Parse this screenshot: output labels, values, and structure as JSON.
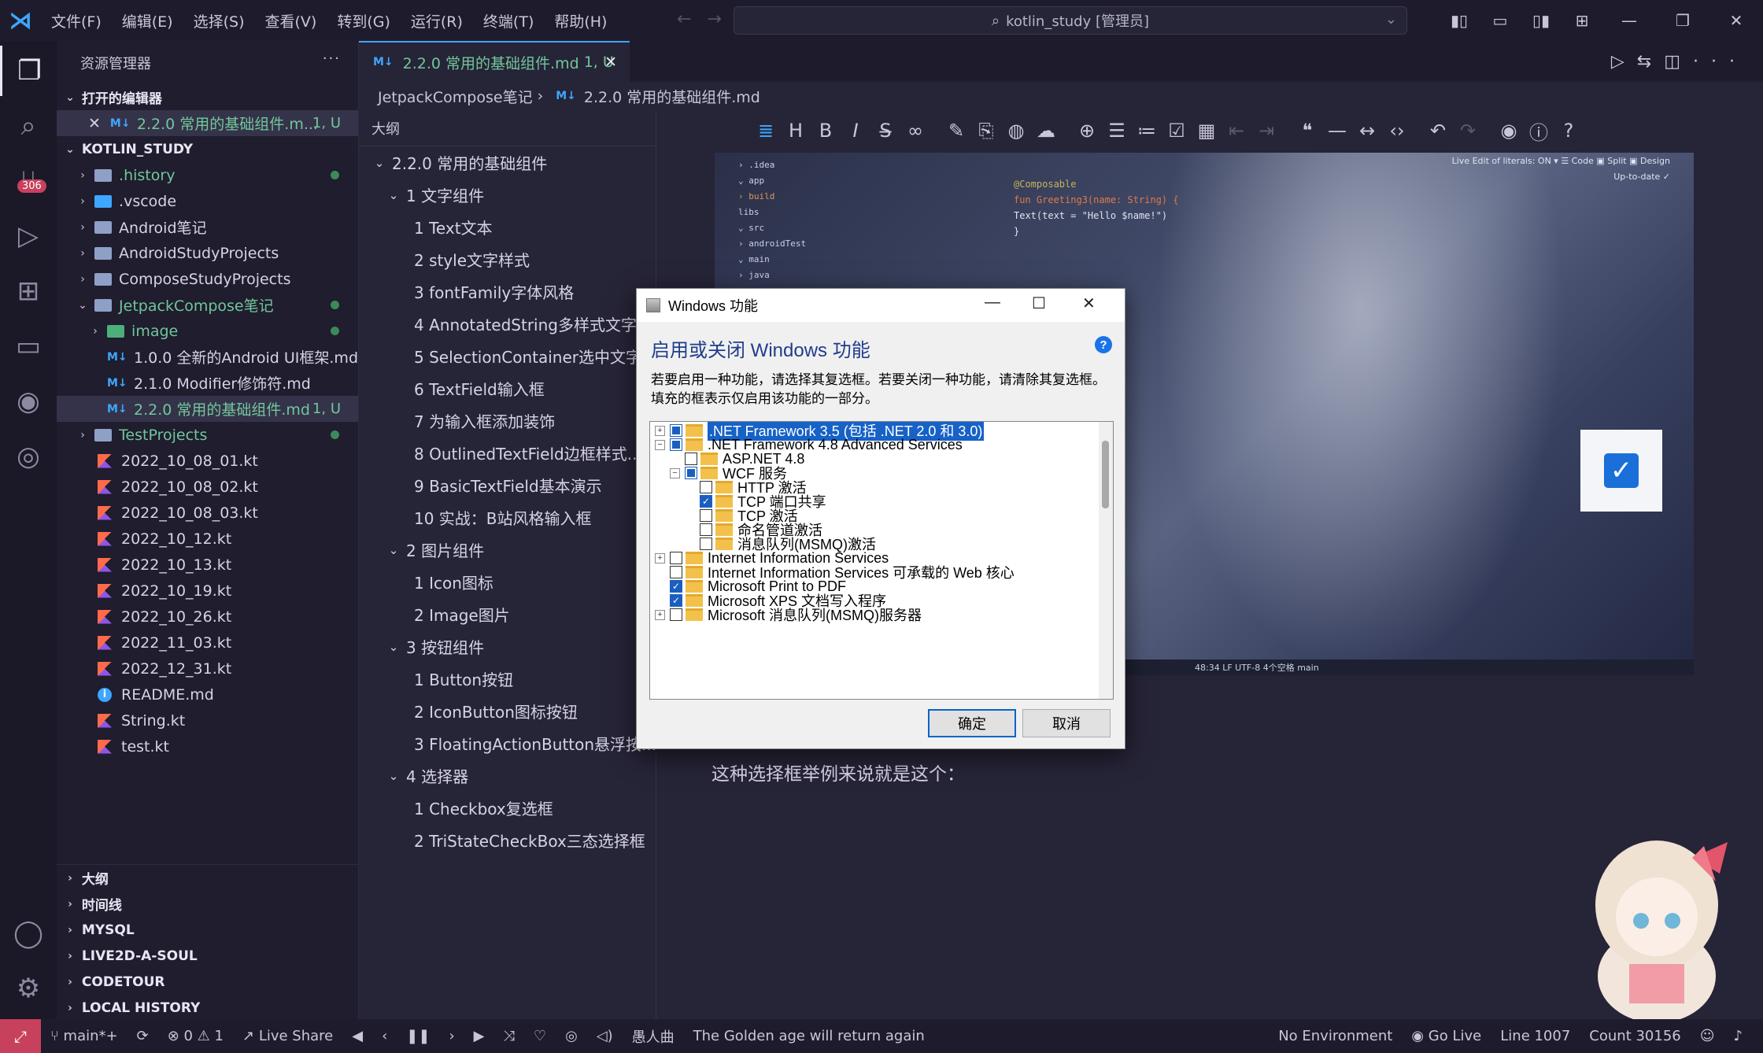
{
  "titlebar": {
    "menus": [
      "文件(F)",
      "编辑(E)",
      "选择(S)",
      "查看(V)",
      "转到(G)",
      "运行(R)",
      "终端(T)",
      "帮助(H)"
    ],
    "search": "kotlin_study [管理员]"
  },
  "activity": {
    "scm_badge": "306"
  },
  "explorer": {
    "title": "资源管理器",
    "open_editors_label": "打开的编辑器",
    "open_editor": {
      "name": "2.2.0 常用的基础组件.m...",
      "suffix": "1, U"
    },
    "root_label": "KOTLIN_STUDY",
    "items": [
      {
        "name": ".history"
      },
      {
        "name": ".vscode"
      },
      {
        "name": "Android笔记"
      },
      {
        "name": "AndroidStudyProjects"
      },
      {
        "name": "ComposeStudyProjects"
      },
      {
        "name": "JetpackCompose笔记"
      },
      {
        "name": "image"
      },
      {
        "name": "1.0.0 全新的Android UI框架.md"
      },
      {
        "name": "2.1.0 Modifier修饰符.md"
      },
      {
        "name": "2.2.0 常用的基础组件.md",
        "suffix": "1, U"
      },
      {
        "name": "TestProjects"
      },
      {
        "name": "2022_10_08_01.kt"
      },
      {
        "name": "2022_10_08_02.kt"
      },
      {
        "name": "2022_10_08_03.kt"
      },
      {
        "name": "2022_10_12.kt"
      },
      {
        "name": "2022_10_13.kt"
      },
      {
        "name": "2022_10_19.kt"
      },
      {
        "name": "2022_10_26.kt"
      },
      {
        "name": "2022_11_03.kt"
      },
      {
        "name": "2022_12_31.kt"
      },
      {
        "name": "README.md"
      },
      {
        "name": "String.kt"
      },
      {
        "name": "test.kt"
      }
    ],
    "bottom_sections": [
      "大纲",
      "时间线",
      "MYSQL",
      "LIVE2D-A-SOUL",
      "CODETOUR",
      "LOCAL HISTORY"
    ]
  },
  "editor": {
    "tab_label": "2.2.0 常用的基础组件.md",
    "tab_suffix": "1, U",
    "breadcrumb": [
      "JetpackCompose笔记",
      "2.2.0 常用的基础组件.md"
    ]
  },
  "outline": {
    "title": "大纲",
    "items": [
      "2.2.0 常用的基础组件",
      "1 文字组件",
      "1 Text文本",
      "2 style文字样式",
      "3 fontFamily字体风格",
      "4 AnnotatedString多样式文字",
      "5 SelectionContainer选中文字",
      "6 TextField输入框",
      "7 为输入框添加装饰",
      "8 OutlinedTextField边框样式...",
      "9 BasicTextField基本演示",
      "10 实战：B站风格输入框",
      "2 图片组件",
      "1 Icon图标",
      "2 Image图片",
      "3 按钮组件",
      "1 Button按钮",
      "2 IconButton图标按钮",
      "3 FloatingActionButton悬浮按...",
      "4 选择器",
      "1 Checkbox复选框",
      "2 TriStateCheckBox三态选择框"
    ]
  },
  "markdown": {
    "paragraph": "这种选择框举例来说就是这个：",
    "screenshot": {
      "tree": [
        "› .idea",
        "⌄ app",
        "  › build",
        "    libs",
        "  ⌄ src",
        "    › androidTest",
        "    ⌄ main",
        "      › java"
      ],
      "code": [
        "@Composable",
        "fun Greeting3(name: String) {",
        "    Text(text = \"Hello $name!\")",
        "}"
      ],
      "topbar": "Live Edit of literals: ON  ▾   ☰ Code  ▣ Split  ▣ Design",
      "uptodate": "Up-to-date ✓",
      "status": "48:34  LF  UTF-8  4个空格  main"
    }
  },
  "dialog": {
    "title": "Windows 功能",
    "heading": "启用或关闭 Windows 功能",
    "description": "若要启用一种功能，请选择其复选框。若要关闭一种功能，请清除其复选框。填充的框表示仅启用该功能的一部分。",
    "features": [
      {
        "label": ".NET Framework 3.5 (包括 .NET 2.0 和 3.0)",
        "state": "partial",
        "expand": "+"
      },
      {
        "label": ".NET Framework 4.8 Advanced Services",
        "state": "partial",
        "expand": "−"
      },
      {
        "label": "ASP.NET 4.8",
        "state": "off",
        "expand": ""
      },
      {
        "label": "WCF 服务",
        "state": "partial",
        "expand": "−"
      },
      {
        "label": "HTTP 激活",
        "state": "off",
        "expand": ""
      },
      {
        "label": "TCP 端口共享",
        "state": "on",
        "expand": ""
      },
      {
        "label": "TCP 激活",
        "state": "off",
        "expand": ""
      },
      {
        "label": "命名管道激活",
        "state": "off",
        "expand": ""
      },
      {
        "label": "消息队列(MSMQ)激活",
        "state": "off",
        "expand": ""
      },
      {
        "label": "Internet Information Services",
        "state": "off",
        "expand": "+"
      },
      {
        "label": "Internet Information Services 可承载的 Web 核心",
        "state": "off",
        "expand": ""
      },
      {
        "label": "Microsoft Print to PDF",
        "state": "on",
        "expand": ""
      },
      {
        "label": "Microsoft XPS 文档写入程序",
        "state": "on",
        "expand": ""
      },
      {
        "label": "Microsoft 消息队列(MSMQ)服务器",
        "state": "off",
        "expand": "+"
      }
    ],
    "ok": "确定",
    "cancel": "取消"
  },
  "statusbar": {
    "branch": "main*+",
    "problems": "⊗ 0 ⚠ 1",
    "liveshare": "Live Share",
    "music_artist": "愚人曲",
    "music_title": "The Golden age will return again",
    "env": "No Environment",
    "golive": "Go Live",
    "line": "Line 1007",
    "count": "Count 30156"
  }
}
